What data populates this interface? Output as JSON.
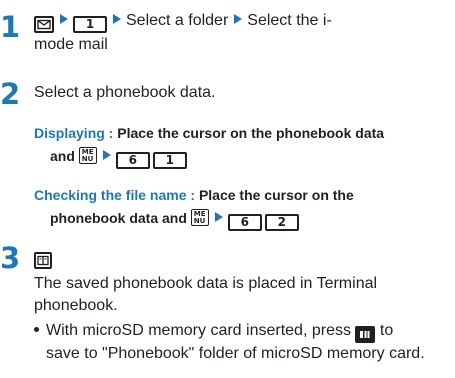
{
  "colors": {
    "step_number": "#1f77b4",
    "highlight": "#1f77b4",
    "text": "#231f20"
  },
  "step1": {
    "number": "1",
    "key_digit": "1",
    "text_a": "Select a folder",
    "text_b": "Select the i-",
    "text_c": "mode mail"
  },
  "step2": {
    "number": "2",
    "title": "Select a phonebook data.",
    "displaying": {
      "label": "Displaying :",
      "text_a": "Place the cursor on the phonebook data",
      "text_b": "and",
      "key_a": "6",
      "key_b": "1"
    },
    "checking": {
      "label": "Checking the file name :",
      "text_a": "Place the cursor on the",
      "text_b": "phonebook data and",
      "key_a": "6",
      "key_b": "2"
    }
  },
  "step3": {
    "number": "3",
    "desc_a": "The saved phonebook data is placed in Terminal",
    "desc_b": "phonebook.",
    "bullet_a": "With microSD memory card inserted, press",
    "bullet_b": "to",
    "bullet_c": "save to \"Phonebook\" folder of microSD memory card."
  },
  "icons": {
    "mail_key": "envelope-key-icon",
    "arrow": "triangle-right-icon",
    "menu_key": "menu-key-icon",
    "book_key": "phonebook-key-icon",
    "external_key": "external-memory-key-icon"
  }
}
